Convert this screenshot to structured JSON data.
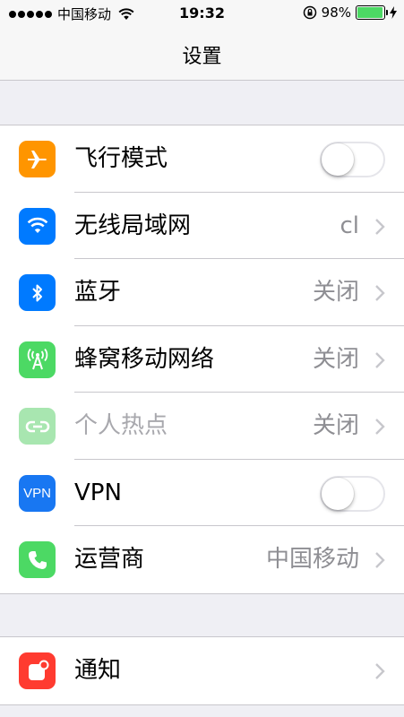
{
  "status_bar": {
    "carrier": "中国移动",
    "time": "19:32",
    "battery": "98%",
    "battery_level": 0.98
  },
  "nav": {
    "title": "设置"
  },
  "group1": [
    {
      "id": "airplane",
      "label": "飞行模式",
      "control": "toggle",
      "on": false,
      "icon": "airplane-icon",
      "color": "#ff9500"
    },
    {
      "id": "wlan",
      "label": "无线局域网",
      "value": "cl",
      "control": "chevron",
      "icon": "wifi-icon",
      "color": "#007aff"
    },
    {
      "id": "bluetooth",
      "label": "蓝牙",
      "value": "关闭",
      "control": "chevron",
      "icon": "bluetooth-icon",
      "color": "#007aff"
    },
    {
      "id": "cellular",
      "label": "蜂窝移动网络",
      "value": "关闭",
      "control": "chevron",
      "icon": "cellular-icon",
      "color": "#4cd964"
    },
    {
      "id": "hotspot",
      "label": "个人热点",
      "value": "关闭",
      "control": "chevron",
      "icon": "hotspot-icon",
      "color": "#a8e6b0",
      "disabled": true
    },
    {
      "id": "vpn",
      "label": "VPN",
      "icon_text": "VPN",
      "control": "toggle",
      "on": false,
      "icon": "vpn-icon",
      "color": "#1877f2"
    },
    {
      "id": "carrier",
      "label": "运营商",
      "value": "中国移动",
      "control": "chevron",
      "icon": "phone-icon",
      "color": "#4cd964"
    }
  ],
  "group2": [
    {
      "id": "notifications",
      "label": "通知",
      "control": "chevron",
      "icon": "notifications-icon",
      "color": "#ff3b30"
    }
  ]
}
